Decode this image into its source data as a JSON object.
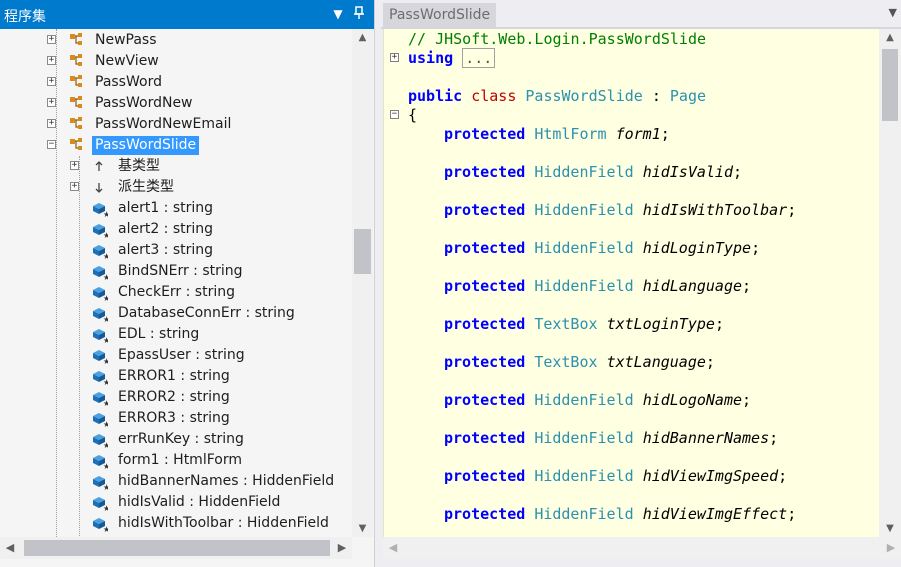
{
  "assembly_panel": {
    "title": "程序集",
    "dropdown_icon": "dropdown-triangle",
    "pin_icon": "pin-icon",
    "tree": [
      {
        "label": "NewPass",
        "kind": "class",
        "expander": "+"
      },
      {
        "label": "NewView",
        "kind": "class",
        "expander": "+"
      },
      {
        "label": "PassWord",
        "kind": "class",
        "expander": "+"
      },
      {
        "label": "PassWordNew",
        "kind": "class",
        "expander": "+"
      },
      {
        "label": "PassWordNewEmail",
        "kind": "class",
        "expander": "+"
      },
      {
        "label": "PassWordSlide",
        "kind": "class",
        "expander": "−",
        "selected": true
      },
      {
        "label": "基类型",
        "kind": "base-types",
        "expander": "+"
      },
      {
        "label": "派生类型",
        "kind": "derived-types",
        "expander": "+"
      },
      {
        "label": "alert1 : string",
        "kind": "field"
      },
      {
        "label": "alert2 : string",
        "kind": "field"
      },
      {
        "label": "alert3 : string",
        "kind": "field"
      },
      {
        "label": "BindSNErr : string",
        "kind": "field"
      },
      {
        "label": "CheckErr : string",
        "kind": "field"
      },
      {
        "label": "DatabaseConnErr : string",
        "kind": "field"
      },
      {
        "label": "EDL : string",
        "kind": "field"
      },
      {
        "label": "EpassUser : string",
        "kind": "field"
      },
      {
        "label": "ERROR1 : string",
        "kind": "field"
      },
      {
        "label": "ERROR2 : string",
        "kind": "field"
      },
      {
        "label": "ERROR3 : string",
        "kind": "field"
      },
      {
        "label": "errRunKey : string",
        "kind": "field"
      },
      {
        "label": "form1 : HtmlForm",
        "kind": "field"
      },
      {
        "label": "hidBannerNames : HiddenField",
        "kind": "field"
      },
      {
        "label": "hidIsValid : HiddenField",
        "kind": "field"
      },
      {
        "label": "hidIsWithToolbar : HiddenField",
        "kind": "field"
      }
    ]
  },
  "editor": {
    "tab_label": "PassWordSlide",
    "tab_menu_icon": "dropdown-triangle",
    "comment": "// JHSoft.Web.Login.PassWordSlide",
    "using_kw": "using",
    "using_collapsed": "...",
    "class_decl": {
      "mod": "public",
      "kw": "class",
      "name": "PassWordSlide",
      "sep": " : ",
      "base": "Page"
    },
    "open_brace": "{",
    "members": [
      {
        "mod": "protected",
        "type": "HtmlForm",
        "name": "form1"
      },
      {
        "mod": "protected",
        "type": "HiddenField",
        "name": "hidIsValid"
      },
      {
        "mod": "protected",
        "type": "HiddenField",
        "name": "hidIsWithToolbar"
      },
      {
        "mod": "protected",
        "type": "HiddenField",
        "name": "hidLoginType"
      },
      {
        "mod": "protected",
        "type": "HiddenField",
        "name": "hidLanguage"
      },
      {
        "mod": "protected",
        "type": "TextBox",
        "name": "txtLoginType"
      },
      {
        "mod": "protected",
        "type": "TextBox",
        "name": "txtLanguage"
      },
      {
        "mod": "protected",
        "type": "HiddenField",
        "name": "hidLogoName"
      },
      {
        "mod": "protected",
        "type": "HiddenField",
        "name": "hidBannerNames"
      },
      {
        "mod": "protected",
        "type": "HiddenField",
        "name": "hidViewImgSpeed"
      },
      {
        "mod": "protected",
        "type": "HiddenField",
        "name": "hidViewImgEffect"
      }
    ]
  },
  "colors": {
    "title_bar": "#007acc",
    "selection": "#3399ff",
    "editor_bg": "#ffffe1",
    "keyword": "#0000ff",
    "type": "#2b91af",
    "comment": "#008000",
    "class_kw": "#c00000"
  }
}
